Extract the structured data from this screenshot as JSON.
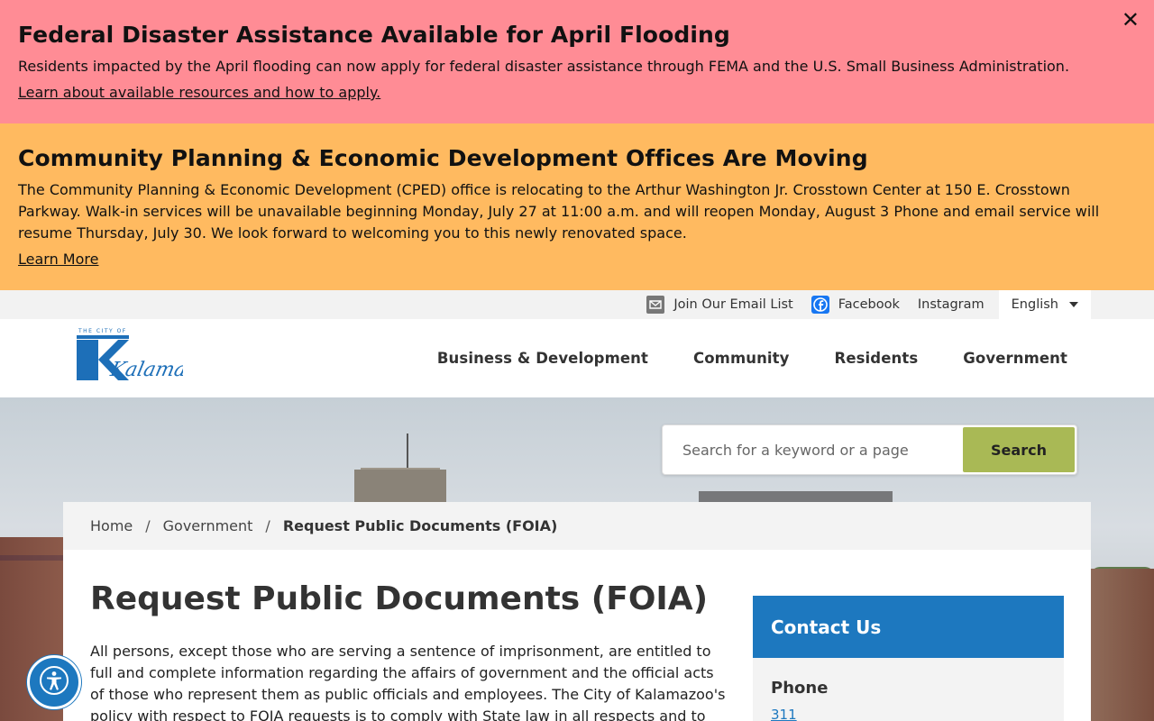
{
  "alerts": [
    {
      "title": "Federal Disaster Assistance Available for April Flooding",
      "body": "Residents impacted by the April flooding can now apply for federal disaster assistance through FEMA and the U.S. Small Business Administration.",
      "link": "Learn about available resources and how to apply.",
      "close": "✕"
    },
    {
      "title": "Community Planning & Economic Development Offices Are Moving",
      "body": "The Community Planning & Economic Development (CPED) office is relocating to the Arthur Washington Jr. Crosstown Center at 150 E. Crosstown Parkway. Walk-in services will be unavailable beginning Monday, July 27 at 11:00 a.m. and will reopen Monday, August 3 Phone and email service will resume Thursday, July 30. We look forward to welcoming you to this newly renovated space.",
      "link": "Learn More"
    }
  ],
  "topbar": {
    "email_label": "Join Our Email List",
    "facebook_label": "Facebook",
    "instagram_label": "Instagram",
    "language": "English"
  },
  "logo": {
    "top_text": "THE CITY OF",
    "name": "Kalamazoo"
  },
  "nav": {
    "items": [
      "Business & Development",
      "Community",
      "Residents",
      "Government"
    ]
  },
  "search": {
    "placeholder": "Search for a keyword or a page",
    "button": "Search"
  },
  "breadcrumb": {
    "home": "Home",
    "sep": "/",
    "parent": "Government",
    "current": "Request Public Documents (FOIA)"
  },
  "page": {
    "title": "Request Public Documents (FOIA)",
    "intro": "All persons, except those who are serving a sentence of imprisonment, are entitled to full and complete information regarding the affairs of government and the official acts of those who represent them as public officials and employees. The City of Kalamazoo's policy with respect to FOIA requests is to comply with State law in all respects and to"
  },
  "contact": {
    "title": "Contact Us",
    "phone_label": "Phone",
    "phone_value": "311"
  },
  "colors": {
    "alert_red": "#ff8c95",
    "alert_orange": "#ffba60",
    "brand_blue": "#1d78bf",
    "search_green": "#a9b955"
  }
}
